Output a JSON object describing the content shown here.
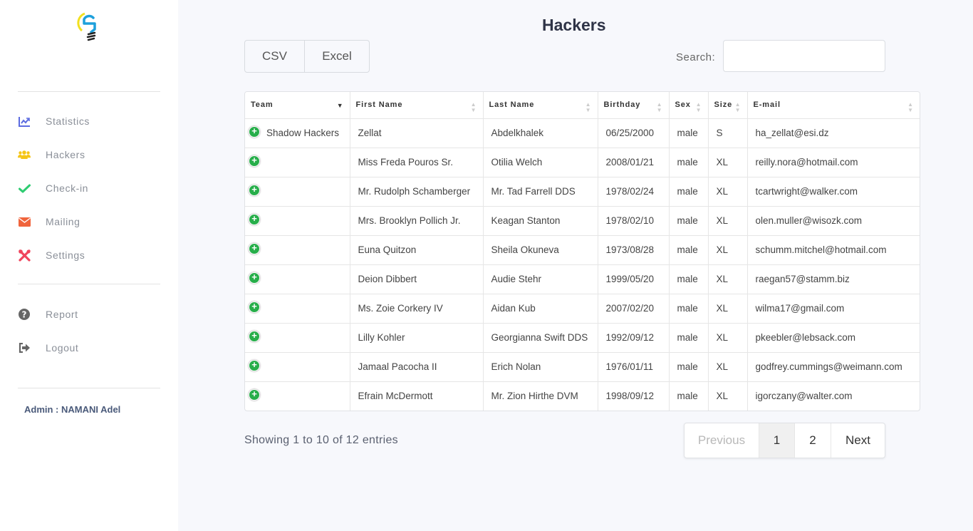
{
  "page": {
    "title": "Hackers"
  },
  "sidebar": {
    "items": [
      {
        "label": "Statistics",
        "icon": "chart-line-icon",
        "color": "#5b6be0"
      },
      {
        "label": "Hackers",
        "icon": "users-icon",
        "color": "#f5c518"
      },
      {
        "label": "Check-in",
        "icon": "check-icon",
        "color": "#2ecc71"
      },
      {
        "label": "Mailing",
        "icon": "envelope-icon",
        "color": "#f0643c"
      },
      {
        "label": "Settings",
        "icon": "tools-icon",
        "color": "#f0445c"
      }
    ],
    "secondary": [
      {
        "label": "Report",
        "icon": "question-circle-icon",
        "color": "#666666"
      },
      {
        "label": "Logout",
        "icon": "sign-out-icon",
        "color": "#666666"
      }
    ],
    "admin": "Admin : NAMANI Adel"
  },
  "toolbar": {
    "csv_label": "CSV",
    "excel_label": "Excel",
    "search_label": "Search:",
    "search_value": "",
    "search_placeholder": ""
  },
  "table": {
    "columns": [
      "Team",
      "First Name",
      "Last Name",
      "Birthday",
      "Sex",
      "Size",
      "E-mail"
    ],
    "sorted_column": "Team",
    "rows": [
      {
        "team": "Shadow Hackers",
        "first": "Zellat",
        "last": "Abdelkhalek",
        "birthday": "06/25/2000",
        "sex": "male",
        "size": "S",
        "email": "ha_zellat@esi.dz"
      },
      {
        "team": "",
        "first": "Miss Freda Pouros Sr.",
        "last": "Otilia Welch",
        "birthday": "2008/01/21",
        "sex": "male",
        "size": "XL",
        "email": "reilly.nora@hotmail.com"
      },
      {
        "team": "",
        "first": "Mr. Rudolph Schamberger",
        "last": "Mr. Tad Farrell DDS",
        "birthday": "1978/02/24",
        "sex": "male",
        "size": "XL",
        "email": "tcartwright@walker.com"
      },
      {
        "team": "",
        "first": "Mrs. Brooklyn Pollich Jr.",
        "last": "Keagan Stanton",
        "birthday": "1978/02/10",
        "sex": "male",
        "size": "XL",
        "email": "olen.muller@wisozk.com"
      },
      {
        "team": "",
        "first": "Euna Quitzon",
        "last": "Sheila Okuneva",
        "birthday": "1973/08/28",
        "sex": "male",
        "size": "XL",
        "email": "schumm.mitchel@hotmail.com"
      },
      {
        "team": "",
        "first": "Deion Dibbert",
        "last": "Audie Stehr",
        "birthday": "1999/05/20",
        "sex": "male",
        "size": "XL",
        "email": "raegan57@stamm.biz"
      },
      {
        "team": "",
        "first": "Ms. Zoie Corkery IV",
        "last": "Aidan Kub",
        "birthday": "2007/02/20",
        "sex": "male",
        "size": "XL",
        "email": "wilma17@gmail.com"
      },
      {
        "team": "",
        "first": "Lilly Kohler",
        "last": "Georgianna Swift DDS",
        "birthday": "1992/09/12",
        "sex": "male",
        "size": "XL",
        "email": "pkeebler@lebsack.com"
      },
      {
        "team": "",
        "first": "Jamaal Pacocha II",
        "last": "Erich Nolan",
        "birthday": "1976/01/11",
        "sex": "male",
        "size": "XL",
        "email": "godfrey.cummings@weimann.com"
      },
      {
        "team": "",
        "first": "Efrain McDermott",
        "last": "Mr. Zion Hirthe DVM",
        "birthday": "1998/09/12",
        "sex": "male",
        "size": "XL",
        "email": "igorczany@walter.com"
      }
    ]
  },
  "footer": {
    "info": "Showing 1 to 10 of 12 entries",
    "prev_label": "Previous",
    "pages": [
      "1",
      "2"
    ],
    "current_page": "1",
    "next_label": "Next"
  }
}
